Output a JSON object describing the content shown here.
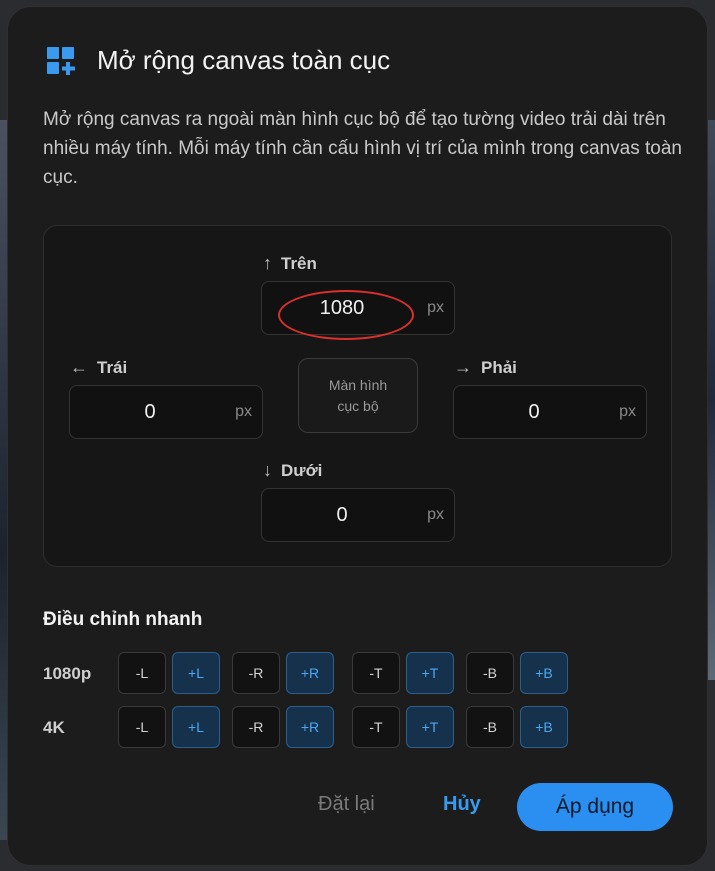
{
  "dialog": {
    "title": "Mở rộng canvas toàn cục",
    "title_icon": "grid-plus-icon",
    "description": "Mở rộng canvas ra ngoài màn hình cục bộ để tạo tường video trải dài trên nhiều máy tính. Mỗi máy tính cần cấu hình vị trí của mình trong canvas toàn cục."
  },
  "edges": {
    "top": {
      "label": "Trên",
      "arrow": "↑",
      "value": "1080",
      "unit": "px"
    },
    "left": {
      "label": "Trái",
      "arrow": "←",
      "value": "0",
      "unit": "px"
    },
    "right": {
      "label": "Phải",
      "arrow": "→",
      "value": "0",
      "unit": "px"
    },
    "bottom": {
      "label": "Dưới",
      "arrow": "↓",
      "value": "0",
      "unit": "px"
    }
  },
  "local_screen": {
    "line1": "Màn hình",
    "line2": "cục bộ"
  },
  "quick": {
    "title": "Điều chỉnh nhanh",
    "rows": [
      {
        "label": "1080p",
        "buttons": [
          "-L",
          "+L",
          "-R",
          "+R",
          "-T",
          "+T",
          "-B",
          "+B"
        ]
      },
      {
        "label": "4K",
        "buttons": [
          "-L",
          "+L",
          "-R",
          "+R",
          "-T",
          "+T",
          "-B",
          "+B"
        ]
      }
    ]
  },
  "actions": {
    "reset": "Đặt lại",
    "cancel": "Hủy",
    "apply": "Áp dụng"
  },
  "colors": {
    "accent": "#2a8ff0",
    "highlight": "#d9302c",
    "dialog_bg": "#1c1c1c"
  }
}
